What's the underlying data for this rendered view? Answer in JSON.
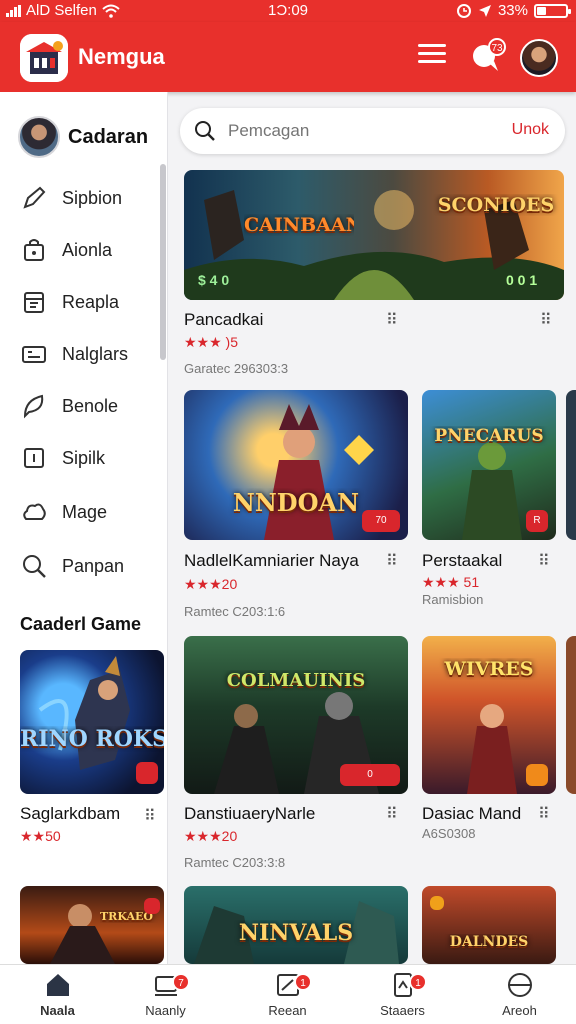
{
  "status_bar": {
    "carrier": "AlD Selfen",
    "time": "1Ɔ:09",
    "battery": "33%",
    "battery_level": 0.33
  },
  "app": {
    "title": "Nemgua",
    "chat_badge": "73"
  },
  "sidebar": {
    "user_name": "Cadaran",
    "items": [
      {
        "label": "Sipbion",
        "icon": "pen-icon"
      },
      {
        "label": "Aionla",
        "icon": "bag-icon"
      },
      {
        "label": "Reapla",
        "icon": "calendar-icon"
      },
      {
        "label": "Nalglars",
        "icon": "card-icon"
      },
      {
        "label": "Benole",
        "icon": "leaf-icon"
      },
      {
        "label": "Sipilk",
        "icon": "square-icon"
      },
      {
        "label": "Mage",
        "icon": "cloud-icon"
      },
      {
        "label": "Panpan",
        "icon": "search-icon"
      }
    ],
    "section_title": "Caaderl Game",
    "games": [
      {
        "art": "RINO ROKSHLAIN",
        "title": "Saglarkdbam",
        "rating": "★★50"
      },
      {
        "art": "TRKAEO",
        "title": "",
        "rating": ""
      }
    ]
  },
  "search": {
    "placeholder": "Pemcagan",
    "action": "Unok"
  },
  "feed": {
    "featured": {
      "art_left": "CAINBAAN",
      "art_right": "SCONIOES",
      "art_badges": "$ 4 0",
      "art_right_badges": "0 0 1",
      "title": "Pancadkai",
      "rating": "★★★ )5",
      "meta": "Garatec 296303:3"
    },
    "row1": [
      {
        "art": "NNDOAN",
        "title": "NadlelKamniarier Naya",
        "rating": "★★★20",
        "meta": "Ramtec C203:1:6",
        "corner": "70"
      },
      {
        "art": "PNECARUS",
        "title": "Perstaakal",
        "rating": "★★★ 51",
        "meta": "Ramisbion",
        "corner": "R"
      }
    ],
    "row2": [
      {
        "art": "COLMAUINIS",
        "title": "DanstiuaeryNarle",
        "rating": "★★★20",
        "meta": "Ramtec C203:3:8",
        "corner": "0"
      },
      {
        "art": "WIVRES",
        "title": "Dasiac Mand",
        "rating": "",
        "meta": "A6S0308",
        "corner": ""
      }
    ],
    "row3": [
      {
        "art": "NINVALS"
      },
      {
        "art": "DALNDES"
      }
    ]
  },
  "bottom_nav": [
    {
      "label": "Naala",
      "icon": "home-icon",
      "badge": ""
    },
    {
      "label": "Naanly",
      "icon": "library-icon",
      "badge": "7"
    },
    {
      "label": "Reean",
      "icon": "edit-icon",
      "badge": "1"
    },
    {
      "label": "Staaers",
      "icon": "tablet-icon",
      "badge": "1"
    },
    {
      "label": "Areoh",
      "icon": "globe-icon",
      "badge": ""
    }
  ],
  "colors": {
    "accent": "#e8302c",
    "rating": "#d9262c"
  }
}
